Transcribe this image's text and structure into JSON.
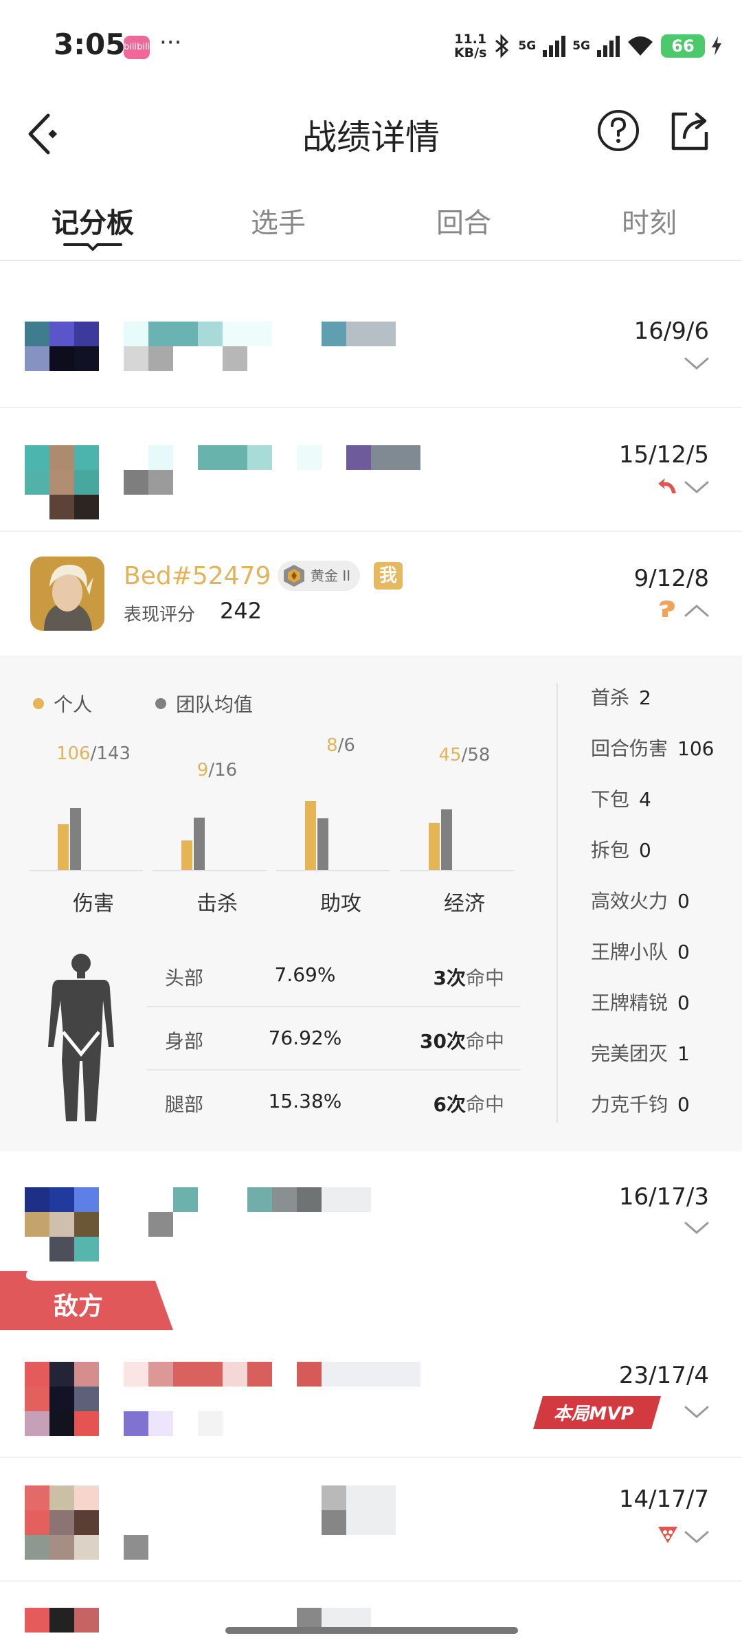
{
  "status_bar": {
    "time": "3:05",
    "app_badge_text": "bilibili",
    "dots": "···",
    "net_speed_value": "11.1",
    "net_speed_unit": "KB/s",
    "signal1": "5G",
    "signal2": "5G",
    "battery": "66"
  },
  "header": {
    "title": "战绩详情"
  },
  "tabs": [
    {
      "label": "记分板",
      "active": true
    },
    {
      "label": "选手",
      "active": false
    },
    {
      "label": "回合",
      "active": false
    },
    {
      "label": "时刻",
      "active": false
    }
  ],
  "players": {
    "ally": [
      {
        "kda": "16/9/6"
      },
      {
        "kda": "15/12/5"
      },
      {
        "kda": "9/12/8"
      },
      {
        "kda": "16/17/3"
      }
    ],
    "enemy": [
      {
        "kda": "23/17/4"
      },
      {
        "kda": "14/17/7"
      }
    ]
  },
  "me": {
    "name": "Bed#52479",
    "rank": "黄金 II",
    "me_badge": "我",
    "score_label": "表现评分",
    "score": "242"
  },
  "detail": {
    "legend_personal": "个人",
    "legend_team": "团队均值",
    "colors": {
      "personal": "#e4b455",
      "team": "#808080"
    },
    "chart_data": {
      "type": "bar",
      "categories": [
        "伤害",
        "击杀",
        "助攻",
        "经济"
      ],
      "series": [
        {
          "name": "个人",
          "values": [
            106,
            9,
            8,
            45
          ]
        },
        {
          "name": "团队均值",
          "values": [
            143,
            16,
            6,
            58
          ]
        }
      ],
      "value_labels": [
        {
          "mine": "106",
          "team": "143"
        },
        {
          "mine": "9",
          "team": "16"
        },
        {
          "mine": "8",
          "team": "6"
        },
        {
          "mine": "45",
          "team": "58"
        }
      ]
    },
    "hits": [
      {
        "part": "头部",
        "pct": "7.69%",
        "count": "3",
        "unit": "次",
        "suffix": "命中"
      },
      {
        "part": "身部",
        "pct": "76.92%",
        "count": "30",
        "unit": "次",
        "suffix": "命中"
      },
      {
        "part": "腿部",
        "pct": "15.38%",
        "count": "6",
        "unit": "次",
        "suffix": "命中"
      }
    ],
    "stats": [
      {
        "label": "首杀",
        "value": "2"
      },
      {
        "label": "回合伤害",
        "value": "106"
      },
      {
        "label": "下包",
        "value": "4"
      },
      {
        "label": "拆包",
        "value": "0"
      },
      {
        "label": "高效火力",
        "value": "0"
      },
      {
        "label": "王牌小队",
        "value": "0"
      },
      {
        "label": "王牌精锐",
        "value": "0"
      },
      {
        "label": "完美团灭",
        "value": "1"
      },
      {
        "label": "力克千钧",
        "value": "0"
      }
    ]
  },
  "enemy_label": "敌方",
  "mvp_label": "本局MVP"
}
